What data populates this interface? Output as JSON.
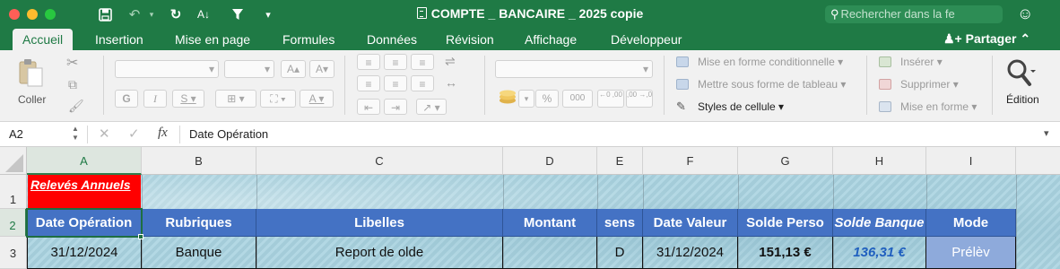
{
  "window": {
    "title": "COMPTE _ BANCAIRE _ 2025 copie",
    "search_placeholder": "Rechercher dans la fe"
  },
  "tabs": [
    "Accueil",
    "Insertion",
    "Mise en page",
    "Formules",
    "Données",
    "Révision",
    "Affichage",
    "Développeur"
  ],
  "active_tab": "Accueil",
  "share_label": "Partager",
  "ribbon": {
    "paste_label": "Coller",
    "bold": "G",
    "italic": "I",
    "underline": "S",
    "font_grow": "A",
    "font_shrink": "A",
    "font_color": "A",
    "percent": "%",
    "thousands": "000",
    "dec_increase": "←0 ,00",
    "dec_decrease": ",00 →,0",
    "conditional_format": "Mise en forme conditionnelle",
    "format_as_table": "Mettre sous forme de tableau",
    "cell_styles": "Styles de cellule",
    "insert": "Insérer",
    "delete": "Supprimer",
    "format": "Mise en forme",
    "edit": "Édition"
  },
  "formula_bar": {
    "cell_ref": "A2",
    "fx": "fx",
    "content": "Date Opération"
  },
  "columns": [
    "A",
    "B",
    "C",
    "D",
    "E",
    "F",
    "G",
    "H",
    "I"
  ],
  "rows": [
    "1",
    "2",
    "3"
  ],
  "cells": {
    "A1": "Relevés Annuels",
    "headers": [
      "Date Opération",
      "Rubriques",
      "Libelles",
      "Montant",
      "sens",
      "Date Valeur",
      "Solde Perso",
      "Solde Banque",
      "Mode"
    ],
    "row3": [
      "31/12/2024",
      "Banque",
      "Report de olde",
      "",
      "D",
      "31/12/2024",
      "151,13 €",
      "136,31 €",
      "Prélèv"
    ]
  },
  "colors": {
    "excel_green": "#1f7a45",
    "header_blue": "#4472c4",
    "relevés_red": "#ff0000",
    "solde_banque_blue": "#1f5fbf",
    "mode_cell": "#8eaadb"
  }
}
